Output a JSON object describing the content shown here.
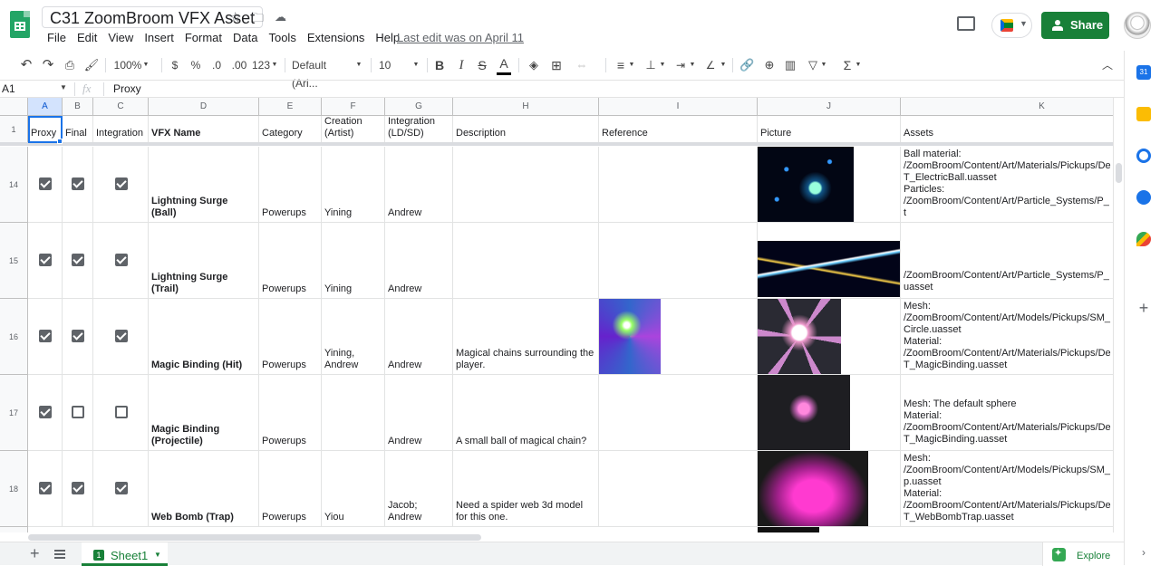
{
  "app": {
    "doc_title": "C31 ZoomBroom VFX Asset",
    "last_edit": "Last edit was on April 11",
    "share_label": "Share",
    "menu": [
      "File",
      "Edit",
      "View",
      "Insert",
      "Format",
      "Data",
      "Tools",
      "Extensions",
      "Help"
    ]
  },
  "toolbar": {
    "zoom": "100%",
    "currency": "$",
    "percent": "%",
    "dec_decrease": ".0",
    "dec_increase": ".00",
    "number_format": "123",
    "font": "Default (Ari...",
    "font_size": "10",
    "bold": "B",
    "italic": "I",
    "strike": "S",
    "text_color": "A"
  },
  "formula_bar": {
    "name_box": "A1",
    "fx": "fx",
    "content": "Proxy"
  },
  "columns": [
    "A",
    "B",
    "C",
    "D",
    "E",
    "F",
    "G",
    "H",
    "I",
    "J",
    "K"
  ],
  "header_row": {
    "num": "1",
    "cells": [
      "Proxy",
      "Final",
      "Integration",
      "VFX Name",
      "Category",
      "Creation\n(Artist)",
      "Integration\n(LD/SD)",
      "Description",
      "Reference",
      "Picture",
      "Assets"
    ]
  },
  "rows": [
    {
      "num": "14",
      "proxy": true,
      "final": true,
      "integration": true,
      "name": "Lightning Surge\n(Ball)",
      "category": "Powerups",
      "artist": "Yining",
      "integrator": "Andrew",
      "description": "",
      "assets": "Ball material:\n/ZoomBroom/Content/Art/Materials/Pickups/De\nT_ElectricBall.uasset\nParticles:\n/ZoomBroom/Content/Art/Particle_Systems/P_\nt"
    },
    {
      "num": "15",
      "proxy": true,
      "final": true,
      "integration": true,
      "name": "Lightning Surge\n(Trail)",
      "category": "Powerups",
      "artist": "Yining",
      "integrator": "Andrew",
      "description": "",
      "assets": "/ZoomBroom/Content/Art/Particle_Systems/P_\nuasset"
    },
    {
      "num": "16",
      "proxy": true,
      "final": true,
      "integration": true,
      "name": "Magic Binding (Hit)",
      "category": "Powerups",
      "artist": "Yining,\nAndrew",
      "integrator": "Andrew",
      "description": "Magical chains surrounding the\nplayer.",
      "assets": "Mesh:\n/ZoomBroom/Content/Art/Models/Pickups/SM_\nCircle.uasset\nMaterial:\n/ZoomBroom/Content/Art/Materials/Pickups/De\nT_MagicBinding.uasset"
    },
    {
      "num": "17",
      "proxy": true,
      "final": false,
      "integration": false,
      "name": "Magic Binding\n(Projectile)",
      "category": "Powerups",
      "artist": "",
      "integrator": "Andrew",
      "description": "A small ball of magical chain?",
      "assets": "Mesh: The default sphere\nMaterial:\n/ZoomBroom/Content/Art/Materials/Pickups/De\nT_MagicBinding.uasset"
    },
    {
      "num": "18",
      "proxy": true,
      "final": true,
      "integration": true,
      "name": "Web Bomb (Trap)",
      "category": "Powerups",
      "artist": "Yiou",
      "integrator": "Jacob;\nAndrew",
      "description": "Need a spider web 3d model\nfor this one.",
      "assets": "Mesh:\n/ZoomBroom/Content/Art/Models/Pickups/SM_\np.uasset\nMaterial:\n/ZoomBroom/Content/Art/Materials/Pickups/De\nT_WebBombTrap.uasset"
    }
  ],
  "sheet_tab": "Sheet1",
  "explore_label": "Explore",
  "icons": {
    "undo": "undo-icon",
    "redo": "redo-icon",
    "print": "print-icon",
    "paint_format": "paint-format-icon",
    "fill": "fill-color-icon",
    "borders": "borders-icon",
    "merge": "merge-icon",
    "align": "align-icon",
    "link": "link-icon",
    "comment": "comment-icon",
    "chart": "chart-icon",
    "filter": "filter-icon",
    "functions": "functions-icon"
  },
  "colors": {
    "brand_green": "#188038",
    "selection_blue": "#1a73e8"
  }
}
